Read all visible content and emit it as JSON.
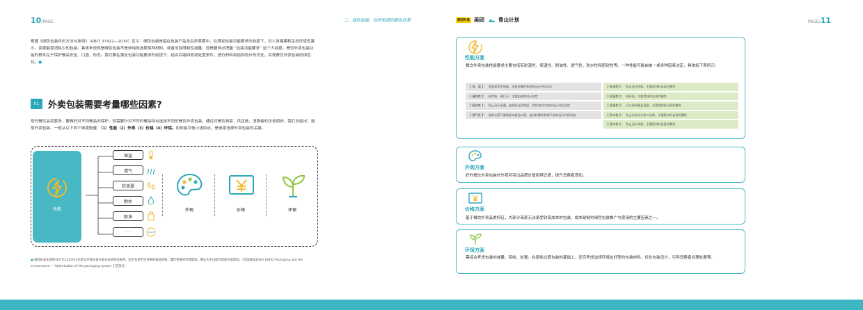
{
  "header": {
    "left_page_number": "10",
    "left_page_label": "/PAGE",
    "right_page_label": "PAGE/",
    "right_page_number": "11",
    "tagline": "二、绿色包装，你所知道的都在这里",
    "brand_meituan": "美团",
    "brand_logo_text": "美团外卖",
    "brand_qingshan": "青山计划"
  },
  "intro": "根据《绿色包装评价方法与准则》（GB/T 37422—2019）定义：绿色包装是指在包装产品全生命周期中，在满足包装功能要求的前提下，对人体健康和生态环境危害小，资源能源消耗少的包装。具体来说就是绿色包装不是单纯地选择某种材料，或者没有限制性减量，而是要务必把握 “包装功能要求” 这个大前提。餐饮外卖包装功能的根本在于保护餐品安全、口感、形态。我们要在满足包装功能要求的前提下，结合后端回收和处置条件，进行材料和结构设计的优化，实现餐饮外卖包装的绿色化。",
  "intro_marker": "●",
  "section": {
    "number": "01",
    "title": "外卖包装需要考量哪些因素?",
    "body_prefix": "现代餐饮品类繁多，要做好对不同餐品的保护，就需要针对不同的餐品特点选用不同的餐饮外卖包装。通过对餐饮商家、供应商、消费者的访谈调研，我们总结出：选取外卖包装，一般从以下四个维度衡量：",
    "body_bold": "（1）性能（2）外观（3）价格（4）环保。",
    "body_suffix": "如何能平衡上述四点，是商家选择外卖包装的关键。"
  },
  "diagram": {
    "performance": "性能",
    "props": [
      "保温",
      "透气",
      "防渗漏",
      "耐水",
      "耐油",
      "· · · ·"
    ],
    "appearance": "外观",
    "price": "价格",
    "eco": "环保"
  },
  "footnote": {
    "marker": "●",
    "text": "国际标准化组织ISO/TC122/SC4包装与环境分技术委员会的研究表明，因为包装不足导致的商品损毁，爆炸带来的环境影响，要远大于过度包装的负面影响。（见国际标准ISO 18602 Packaging and the environment — Optimization of the packaging system 引言部分）"
  },
  "cards": {
    "performance": {
      "title": "性能方面",
      "text": "餐饮外卖包装性能要求主要包括有耐温性、保温性、耐油性、透气性、防水性和密封性等。一种性能可能由单一或多种因素决定，具体如下表所示：",
      "rows": [
        {
          "lk": "【 强　度 】：",
          "lv": "坚固耐用不易破，由材料属性和结构设计共同决定",
          "rk": "【 耐油性 】：",
          "rv": "防止油汁渗透，主要是材料自身的属性"
        },
        {
          "lk": "【 便利性 】：",
          "lv": "易包装、易打开，主要由结构设计决定",
          "rk": "【 耐温性 】：",
          "rv": "耐高温，主要是材料自身的属性"
        },
        {
          "lk": "【 密封性 】：",
          "lv": "防止汤汁洒漏，由材料自身韧度、韧性和封口结构设计共同决定",
          "rk": "【 保温性 】：",
          "rv": "可以保持餐品温度，主要是材料自身的属性"
        },
        {
          "lk": "【 透气性 】：",
          "lv": "避免水蒸气凝结影响餐品口感，由材料属性和透气结构设计共同决定",
          "rk": "【 防水性 】：",
          "rv": "防止外部水分渗入包装，主要是材料自身的属性"
        },
        {
          "lk": "",
          "lv": "",
          "rk": "【 耐水性 】：",
          "rv": "防止汤水渗透，主要是材料自身的属性"
        }
      ]
    },
    "appearance": {
      "title": "外观方面",
      "text": "好的餐饮外卖包装的外观可突出品牌价值和辨识度，提升消费者感知。"
    },
    "price": {
      "title": "价格方面",
      "text": "基于餐饮外卖品类特征，大部分商家无法承受较高成本的包装，成本是制约绿色包装推广与使用的主要因素之一。"
    },
    "eco": {
      "title": "环保方面",
      "text": "需综合考虑包装的减量、回收、处置。在避免过度包装的基础上，还应考虑选择环境友好型的包装材料，优化包装设计，引导消费者合理处置等。"
    }
  },
  "colors": {
    "accent": "#2aa7b8",
    "card_border": "#48b9c4",
    "gray_cell": "#e3e3e3",
    "green_cell": "#dcebc6",
    "bottom_bar": "#3cb6c2",
    "icon_yellow": "#f2b82a",
    "icon_green": "#8cc63f"
  }
}
